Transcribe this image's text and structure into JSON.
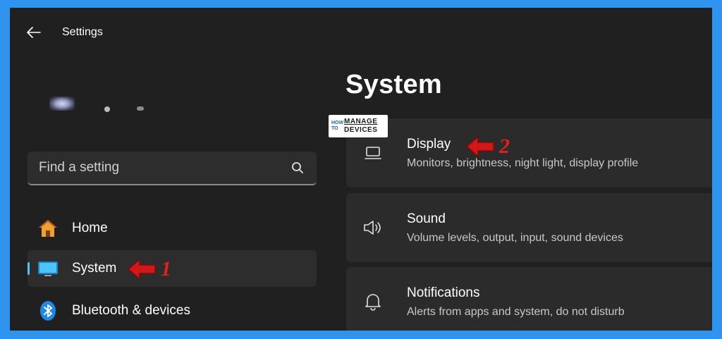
{
  "window": {
    "title": "Settings"
  },
  "sidebar": {
    "search_placeholder": "Find a setting",
    "items": [
      {
        "label": "Home",
        "icon": "home-icon",
        "active": false
      },
      {
        "label": "System",
        "icon": "system-monitor-icon",
        "active": true
      },
      {
        "label": "Bluetooth & devices",
        "icon": "bluetooth-icon",
        "active": false
      }
    ]
  },
  "main": {
    "title": "System",
    "cards": [
      {
        "title": "Display",
        "description": "Monitors, brightness, night light, display profile",
        "icon": "display-icon"
      },
      {
        "title": "Sound",
        "description": "Volume levels, output, input, sound devices",
        "icon": "speaker-icon"
      },
      {
        "title": "Notifications",
        "description": "Alerts from apps and system, do not disturb",
        "icon": "bell-icon"
      }
    ]
  },
  "logo": {
    "line1": "HOW",
    "line2": "TO",
    "line3": "MANAGE",
    "line4": "DEVICES"
  },
  "annotations": [
    {
      "number": "1"
    },
    {
      "number": "2"
    }
  ],
  "colors": {
    "accent": "#4cc2ff",
    "arrow": "#e02020",
    "background": "#202020",
    "frame": "#2f93f0"
  }
}
